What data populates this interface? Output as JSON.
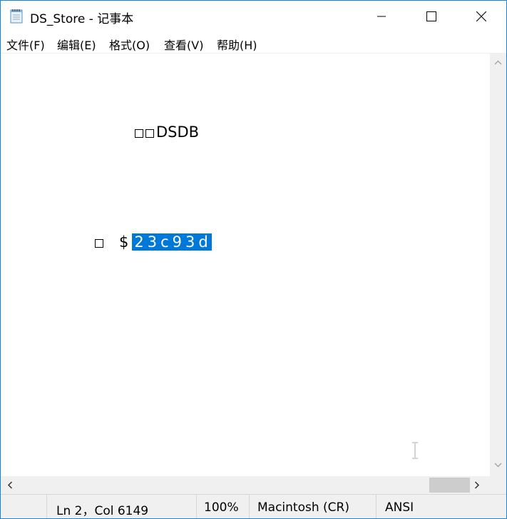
{
  "window": {
    "title": "DS_Store - 记事本",
    "icon": "notepad-icon",
    "buttons": [
      "minimize-icon",
      "maximize-icon",
      "close-icon"
    ]
  },
  "menu": {
    "items": [
      "文件(F)",
      "编辑(E)",
      "格式(O)",
      "查看(V)",
      "帮助(H)"
    ]
  },
  "editor": {
    "line1": "DSDB",
    "line2_prefix": "$",
    "line2_selected": "23c93d",
    "selection_color": "#0078d7"
  },
  "statusbar": {
    "position": "Ln 2，Col 6149",
    "zoom": "100%",
    "line_ending": "Macintosh (CR)",
    "encoding": "ANSI"
  }
}
